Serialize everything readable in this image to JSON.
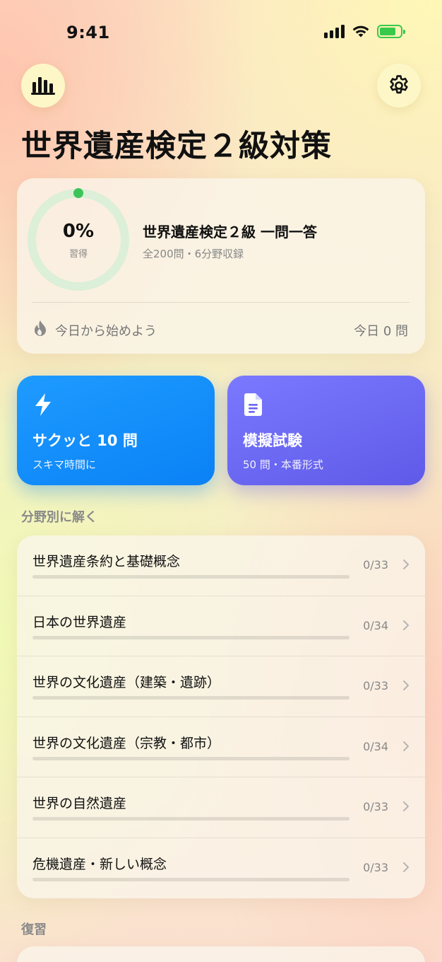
{
  "status_bar": {
    "time": "9:41"
  },
  "page_title": "世界遺産検定２級対策",
  "progress": {
    "percent_label": "0%",
    "percent_value": 0,
    "caption": "習得",
    "course_title": "世界遺産検定２級 一問一答",
    "course_subtitle": "全200問・6分野収録",
    "streak_text": "今日から始めよう",
    "today_count": "今日 0 問"
  },
  "actions": {
    "quick": {
      "title": "サクッと 10 問",
      "subtitle": "スキマ時間に",
      "icon": "bolt-icon"
    },
    "exam": {
      "title": "模擬試験",
      "subtitle": "50 問・本番形式",
      "icon": "document-icon"
    }
  },
  "sections": {
    "categories_label": "分野別に解く",
    "review_label": "復習"
  },
  "categories": [
    {
      "name": "世界遺産条約と基礎概念",
      "count": "0/33",
      "progress": 0
    },
    {
      "name": "日本の世界遺産",
      "count": "0/34",
      "progress": 0
    },
    {
      "name": "世界の文化遺産（建築・遺跡）",
      "count": "0/33",
      "progress": 0
    },
    {
      "name": "世界の文化遺産（宗教・都市）",
      "count": "0/34",
      "progress": 0
    },
    {
      "name": "世界の自然遺産",
      "count": "0/33",
      "progress": 0
    },
    {
      "name": "危機遺産・新しい概念",
      "count": "0/33",
      "progress": 0
    }
  ],
  "colors": {
    "accent_blue": "#0a82f6",
    "accent_purple": "#6a66f2",
    "progress_green": "#3cc45a"
  }
}
